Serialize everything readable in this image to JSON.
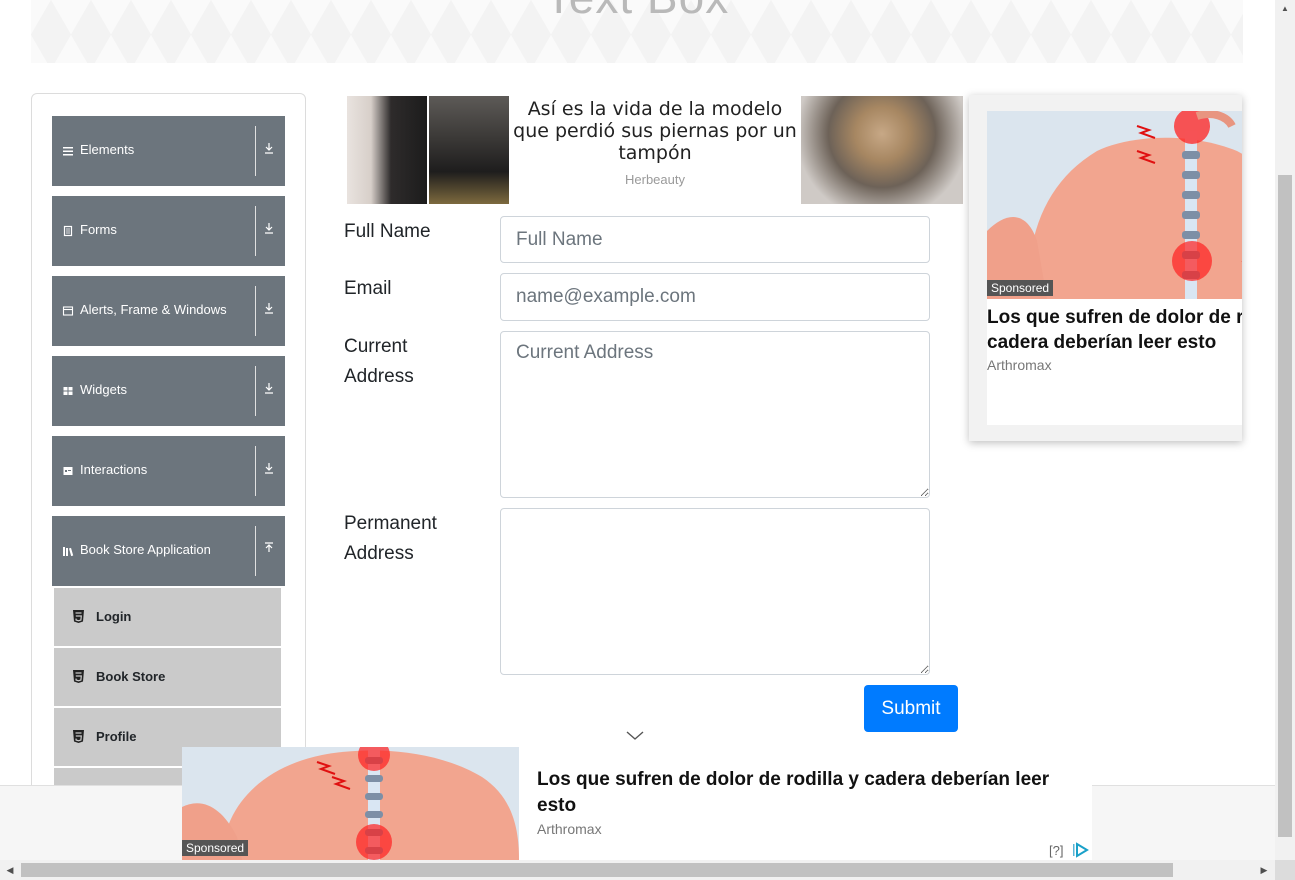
{
  "header": {
    "title": "Text Box"
  },
  "sidebar": {
    "groups": [
      {
        "label": "Elements",
        "icon": "hamburger-icon",
        "arrow": "download-arrow-icon"
      },
      {
        "label": "Forms",
        "icon": "document-icon",
        "arrow": "download-arrow-icon"
      },
      {
        "label": "Alerts, Frame & Windows",
        "icon": "window-icon",
        "arrow": "download-arrow-icon"
      },
      {
        "label": "Widgets",
        "icon": "grid-icon",
        "arrow": "download-arrow-icon"
      },
      {
        "label": "Interactions",
        "icon": "interaction-icon",
        "arrow": "download-arrow-icon"
      },
      {
        "label": "Book Store Application",
        "icon": "books-icon",
        "arrow": "upload-arrow-icon"
      }
    ],
    "sub_items": [
      {
        "label": "Login",
        "icon": "html5-icon"
      },
      {
        "label": "Book Store",
        "icon": "html5-icon"
      },
      {
        "label": "Profile",
        "icon": "html5-icon"
      }
    ]
  },
  "ad_top": {
    "title": "Así es la vida de la modelo que perdió sus piernas por un tampón",
    "source": "Herbeauty"
  },
  "form": {
    "full_name_label": "Full Name",
    "full_name_placeholder": "Full Name",
    "email_label": "Email",
    "email_placeholder": "name@example.com",
    "current_address_label": "Current Address",
    "current_address_placeholder": "Current Address",
    "permanent_address_label": "Permanent Address",
    "submit_label": "Submit"
  },
  "ad_right": {
    "sponsored": "Sponsored",
    "title_line1": "Los que sufren de dolor de rod",
    "title_line2": "cadera deberían leer esto",
    "source": "Arthromax"
  },
  "ad_bottom": {
    "sponsored": "Sponsored",
    "title": "Los que sufren de dolor de rodilla y cadera deberían leer esto",
    "source": "Arthromax",
    "help": "[?]"
  },
  "colors": {
    "sidebar_group": "#6c757d",
    "sub_item": "#cacaca",
    "submit": "#007bff"
  }
}
